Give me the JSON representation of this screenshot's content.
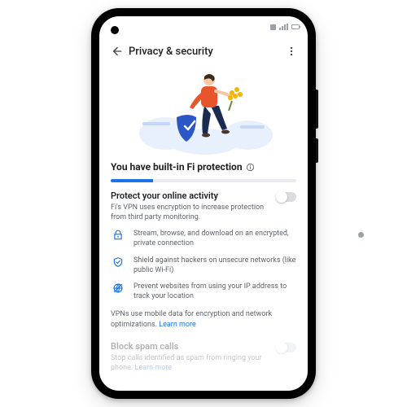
{
  "appbar": {
    "title": "Privacy & security"
  },
  "heading": "You have built-in Fi protection",
  "progress": {
    "percent": 23
  },
  "protect": {
    "title": "Protect your online activity",
    "desc": "Fi's VPN uses encryption to increase protection from third party monitoring.",
    "toggle_on": false
  },
  "bullets": [
    {
      "icon": "lock-icon",
      "text": "Stream, browse, and download on an encrypted, private connection"
    },
    {
      "icon": "shield-icon",
      "text": "Shield against hackers on unsecure networks (like public Wi-Fi)"
    },
    {
      "icon": "globe-icon",
      "text": "Prevent websites from using your IP address to track your location"
    }
  ],
  "footnote": {
    "text": "VPNs use mobile data for encryption and network optimizations. ",
    "link": "Learn more"
  },
  "block_spam": {
    "title": "Block spam calls",
    "desc": "Stop calls identified as spam from ringing your phone. ",
    "link": "Learn more",
    "toggle_on": false
  },
  "colors": {
    "accent": "#1a73e8"
  }
}
